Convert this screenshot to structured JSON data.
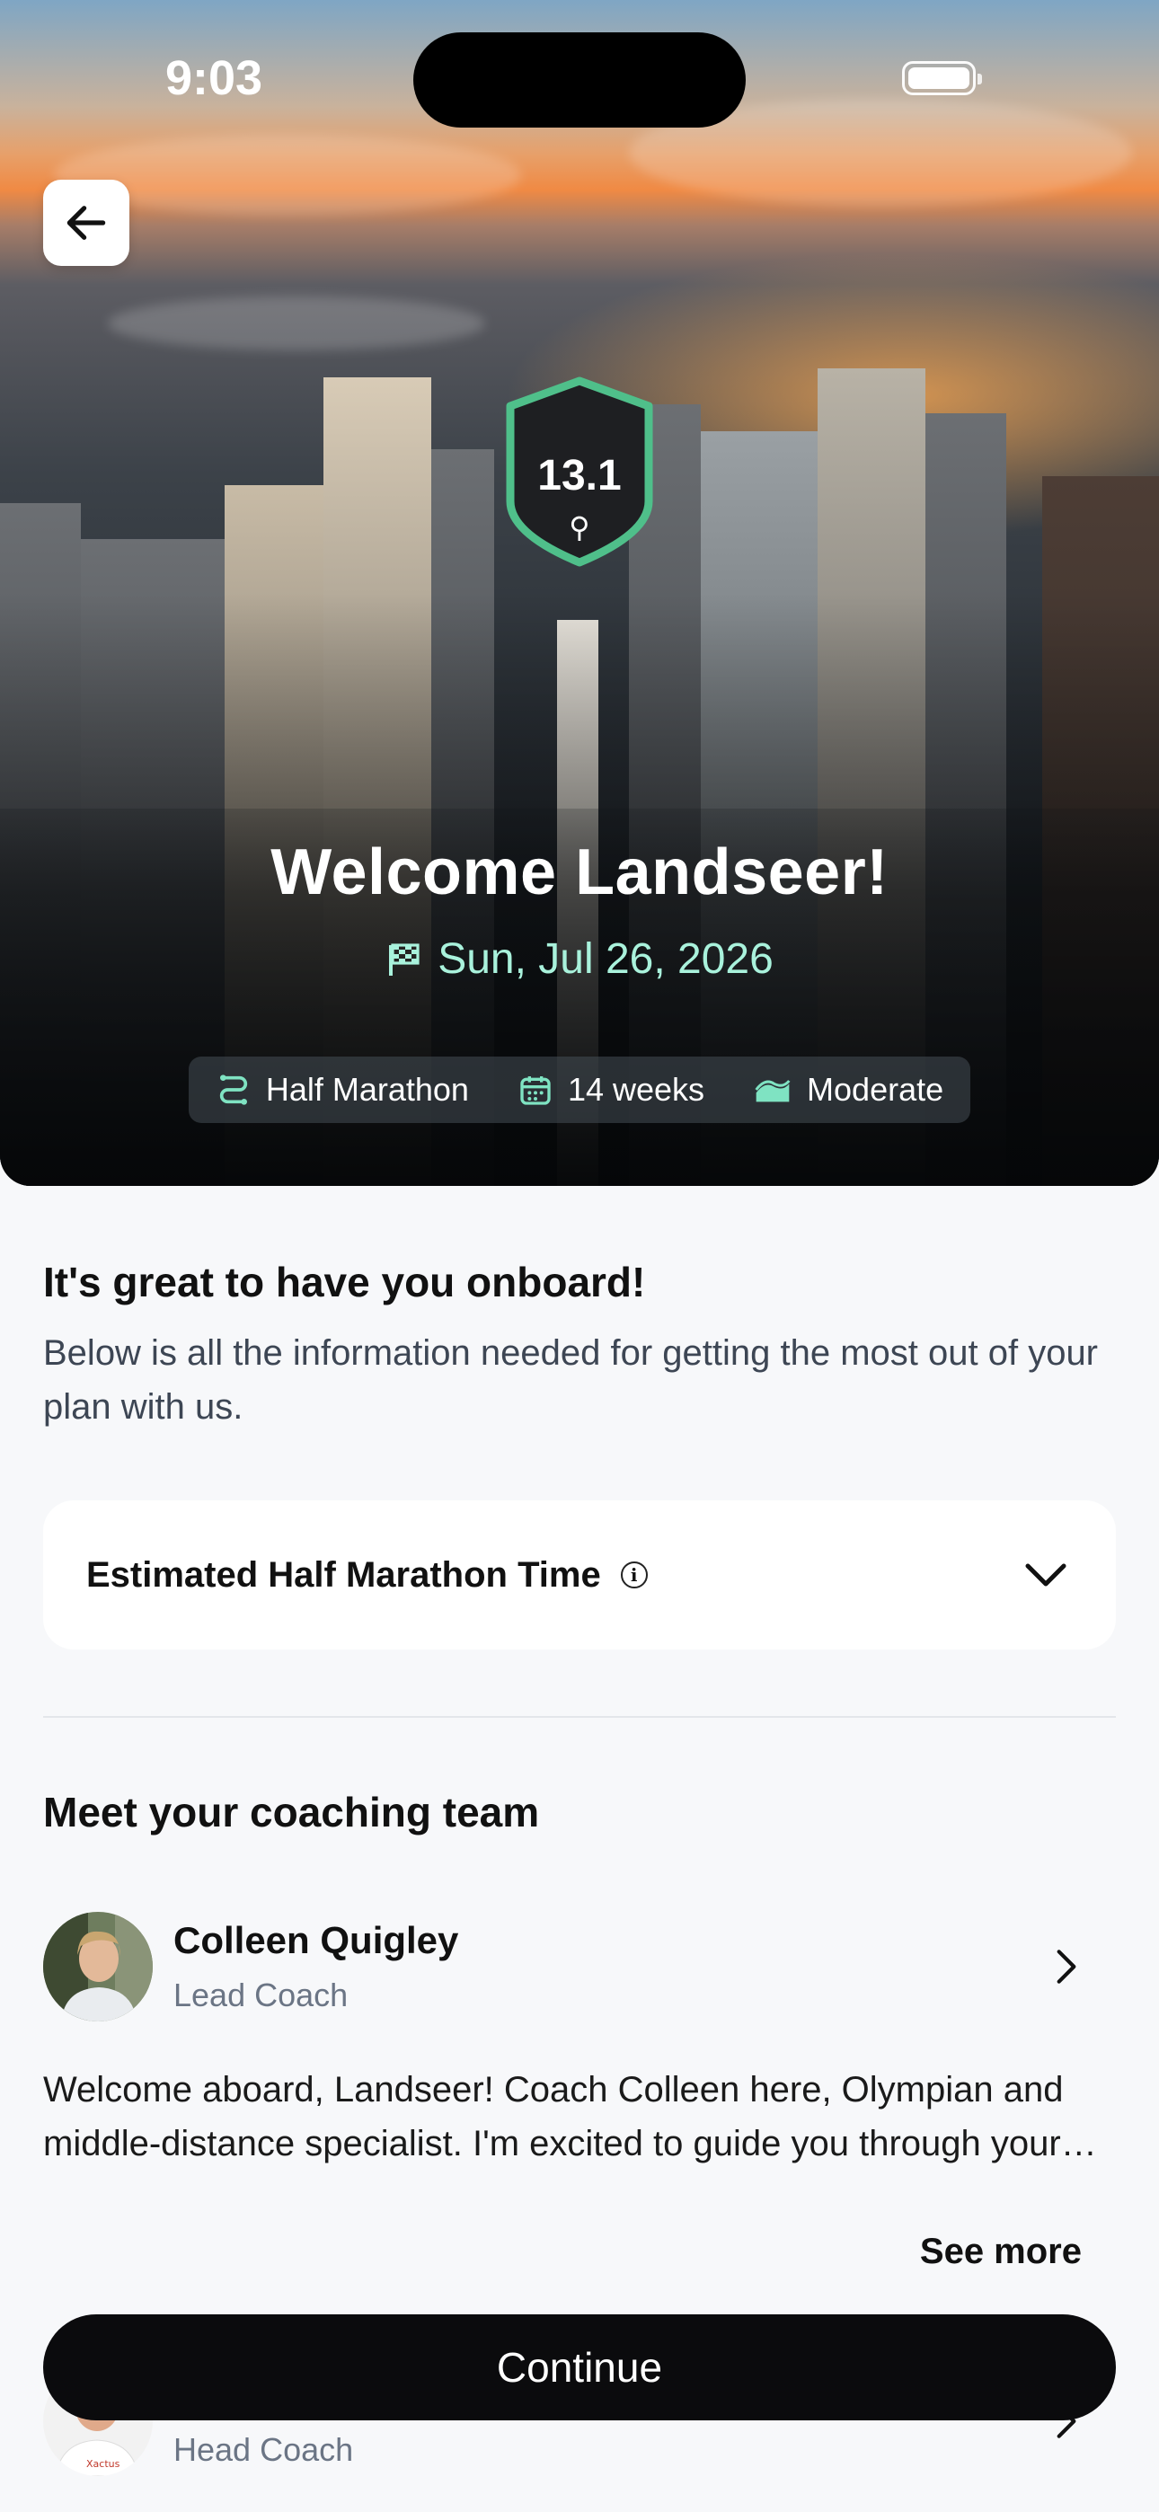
{
  "status_bar": {
    "time": "9:03"
  },
  "hero": {
    "badge_value": "13.1",
    "badge_icon": "runner-icon",
    "welcome_title": "Welcome Landseer!",
    "race_date": "Sun, Jul 26, 2026",
    "chips": [
      {
        "icon": "route-icon",
        "label": "Half Marathon"
      },
      {
        "icon": "calendar-icon",
        "label": "14 weeks"
      },
      {
        "icon": "effort-icon",
        "label": "Moderate"
      }
    ],
    "accent_color": "#4fbf8a",
    "date_color": "#a9f2dc"
  },
  "onboard": {
    "title": "It's great to have you onboard!",
    "description": "Below is all the information needed for getting the most out of your plan with us."
  },
  "estimate": {
    "label": "Estimated Half Marathon Time"
  },
  "team": {
    "title": "Meet your coaching team",
    "coaches": [
      {
        "name": "Colleen Quigley",
        "role": "Lead Coach",
        "bio": "Welcome aboard, Landseer! Coach Colleen here, Olympian and middle-distance specialist. I'm excited to guide you through your training journey."
      },
      {
        "name": "",
        "role": "Head Coach"
      }
    ],
    "see_more": "See more"
  },
  "cta": {
    "continue_label": "Continue"
  }
}
